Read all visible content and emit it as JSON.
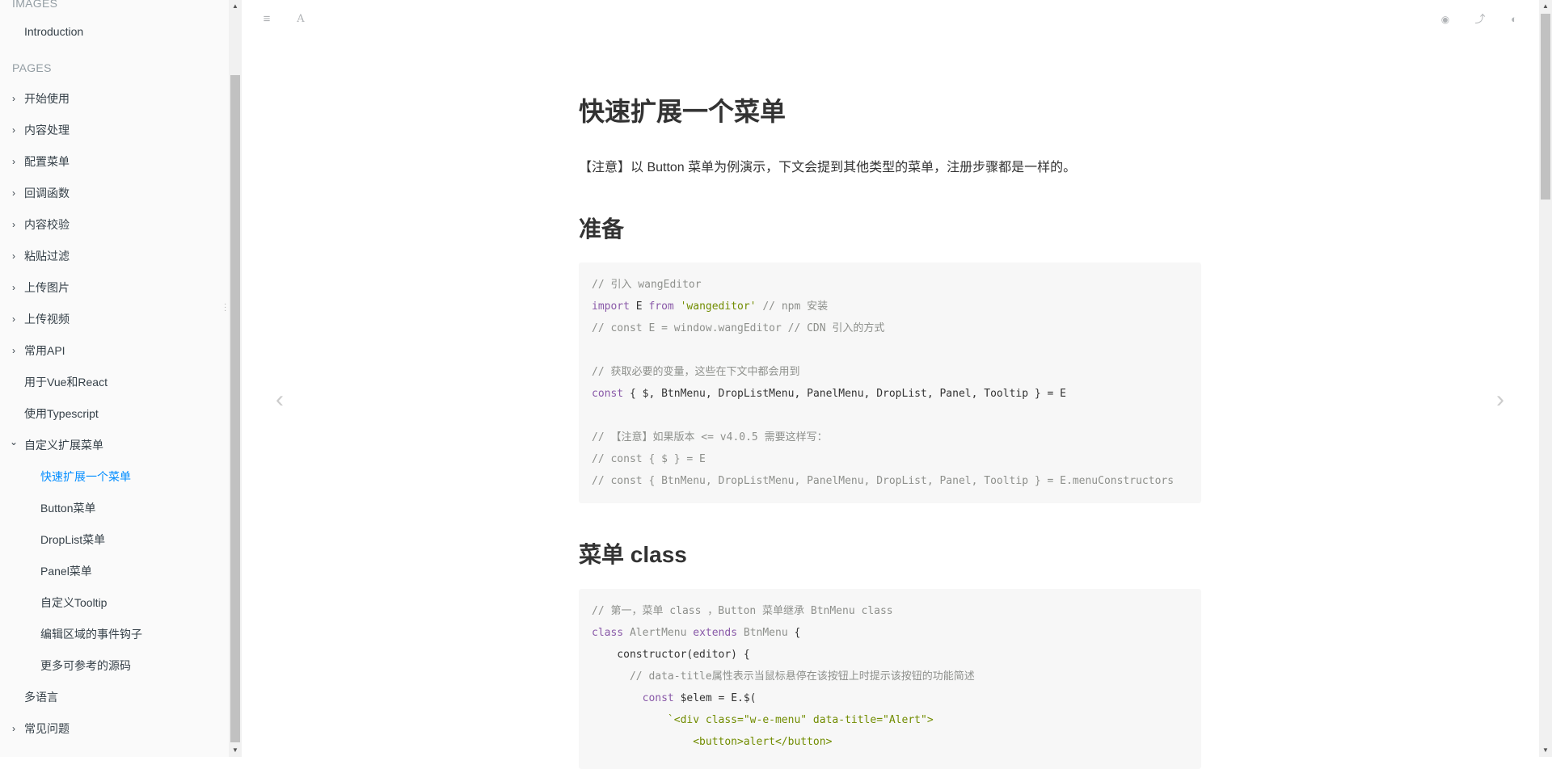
{
  "sidebar": {
    "images_header": "IMAGES",
    "images_items": [
      {
        "label": "Introduction"
      }
    ],
    "pages_header": "PAGES",
    "items": [
      {
        "label": "开始使用",
        "chev": "›"
      },
      {
        "label": "内容处理",
        "chev": "›"
      },
      {
        "label": "配置菜单",
        "chev": "›"
      },
      {
        "label": "回调函数",
        "chev": "›"
      },
      {
        "label": "内容校验",
        "chev": "›"
      },
      {
        "label": "粘贴过滤",
        "chev": "›"
      },
      {
        "label": "上传图片",
        "chev": "›"
      },
      {
        "label": "上传视频",
        "chev": "›"
      },
      {
        "label": "常用API",
        "chev": "›"
      },
      {
        "label": "用于Vue和React",
        "chev": ""
      },
      {
        "label": "使用Typescript",
        "chev": ""
      },
      {
        "label": "自定义扩展菜单",
        "chev": "⌄"
      },
      {
        "label": "快速扩展一个菜单",
        "chev": ""
      },
      {
        "label": "Button菜单",
        "chev": ""
      },
      {
        "label": "DropList菜单",
        "chev": ""
      },
      {
        "label": "Panel菜单",
        "chev": ""
      },
      {
        "label": "自定义Tooltip",
        "chev": ""
      },
      {
        "label": "编辑区域的事件钩子",
        "chev": ""
      },
      {
        "label": "更多可参考的源码",
        "chev": ""
      },
      {
        "label": "多语言",
        "chev": ""
      },
      {
        "label": "常见问题",
        "chev": "›"
      }
    ]
  },
  "toolbar": {
    "menu_icon": "≡",
    "font_icon": "A",
    "weibo_icon": "◉",
    "share_icon": "⤴",
    "github_icon": "◐"
  },
  "article": {
    "title": "快速扩展一个菜单",
    "note": "【注意】以 Button 菜单为例演示，下文会提到其他类型的菜单，注册步骤都是一样的。",
    "section1_title": "准备",
    "section2_title": "菜单 class",
    "code1": {
      "l1": "// 引入 wangEditor",
      "l2_kw": "import",
      "l2_a": " E ",
      "l2_kw2": "from",
      "l2_str": " 'wangeditor'",
      "l2_cmt": " // npm 安装",
      "l3": "// const E = window.wangEditor // CDN 引入的方式",
      "l5": "// 获取必要的变量，这些在下文中都会用到",
      "l6_kw": "const",
      "l6_rest": " { $, BtnMenu, DropListMenu, PanelMenu, DropList, Panel, Tooltip } = E",
      "l8": "// 【注意】如果版本 <= v4.0.5 需要这样写：",
      "l9": "// const { $ } = E",
      "l10": "// const { BtnMenu, DropListMenu, PanelMenu, DropList, Panel, Tooltip } = E.menuConstructors"
    },
    "code2": {
      "l1": "// 第一，菜单 class ，Button 菜单继承 BtnMenu class",
      "l2_kw": "class",
      "l2_cls": " AlertMenu",
      "l2_kw2": " extends",
      "l2_cls2": " BtnMenu",
      "l2_rest": " {",
      "l3": "    constructor(editor) {",
      "l4": "      // data-title属性表示当鼠标悬停在该按钮上时提示该按钮的功能简述",
      "l5_kw": "        const",
      "l5_rest": " $elem = E.$(",
      "l6": "            `<div class=\"w-e-menu\" data-title=\"Alert\">",
      "l7": "                <button>alert</button>"
    }
  },
  "nav": {
    "prev_icon": "‹",
    "next_icon": "›"
  }
}
